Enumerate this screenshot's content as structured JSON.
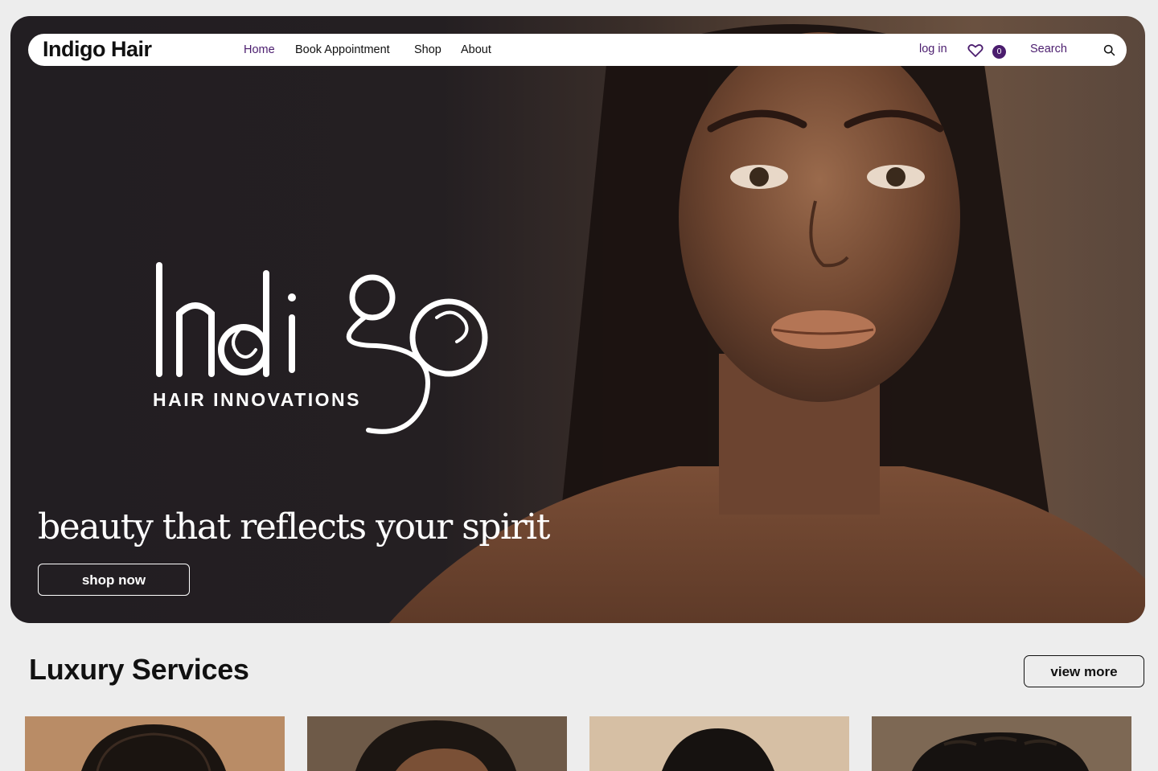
{
  "header": {
    "brand": "Indigo Hair",
    "nav": [
      "Home",
      "Book Appointment",
      "Shop",
      "About"
    ],
    "login": "log in",
    "cart_count": "0",
    "search_label": "Search"
  },
  "hero": {
    "logo_text": "Indigo",
    "logo_subtext": "HAIR INNOVATIONS",
    "tagline": "beauty that reflects your spirit",
    "cta": "shop now"
  },
  "services": {
    "title": "Luxury Services",
    "view_more": "view more"
  },
  "colors": {
    "accent": "#4b1d6e",
    "hero_dark": "#221e22",
    "page_bg": "#ededed"
  }
}
